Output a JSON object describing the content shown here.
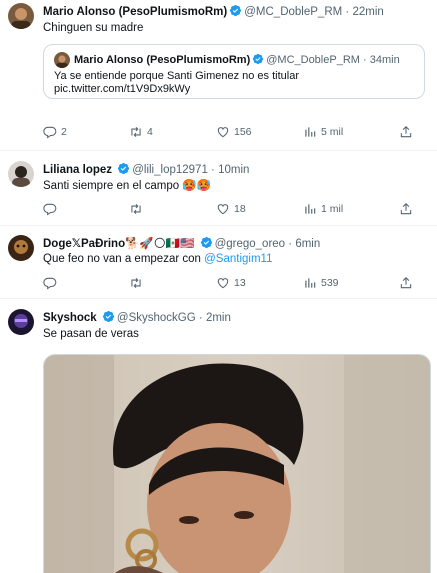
{
  "tweets": [
    {
      "name": "Mario Alonso (PesoPlumismoRm)",
      "handle": "@MC_DobleP_RM",
      "time": "22min",
      "text": "Chinguen su madre",
      "quote": {
        "name": "Mario Alonso (PesoPlumismoRm)",
        "handle": "@MC_DobleP_RM",
        "time": "34min",
        "text_line1": "Ya se entiende porque Santi Gimenez no es titular",
        "text_line2": "pic.twitter.com/t1V9Dx9kWy"
      },
      "replies": "2",
      "retweets": "4",
      "likes": "156",
      "views": "5 mil"
    },
    {
      "name": "Liliana lopez",
      "handle": "@lili_lop12971",
      "time": "10min",
      "text": "Santi siempre en el campo 🥵🥵",
      "replies": "",
      "retweets": "",
      "likes": "18",
      "views": "1 mil"
    },
    {
      "name": "Doge𝕏PaÐrino🐕🚀🌕🇲🇽🇺🇸",
      "handle": "@grego_oreo",
      "time": "6min",
      "text_prefix": "Que feo no van a empezar con ",
      "mention": "@Santigim11",
      "replies": "",
      "retweets": "",
      "likes": "13",
      "views": "539"
    },
    {
      "name": "Skyshock",
      "handle": "@SkyshockGG",
      "time": "2min",
      "text": "Se pasan de veras"
    }
  ],
  "separator": "·",
  "icons": {
    "reply": "reply-icon",
    "retweet": "retweet-icon",
    "like": "heart-icon",
    "views": "views-icon",
    "share": "share-icon",
    "verified": "verified-badge-icon"
  },
  "colors": {
    "text": "#0f1419",
    "secondary": "#536471",
    "link": "#1d9bf0",
    "border": "#eff3f4"
  }
}
